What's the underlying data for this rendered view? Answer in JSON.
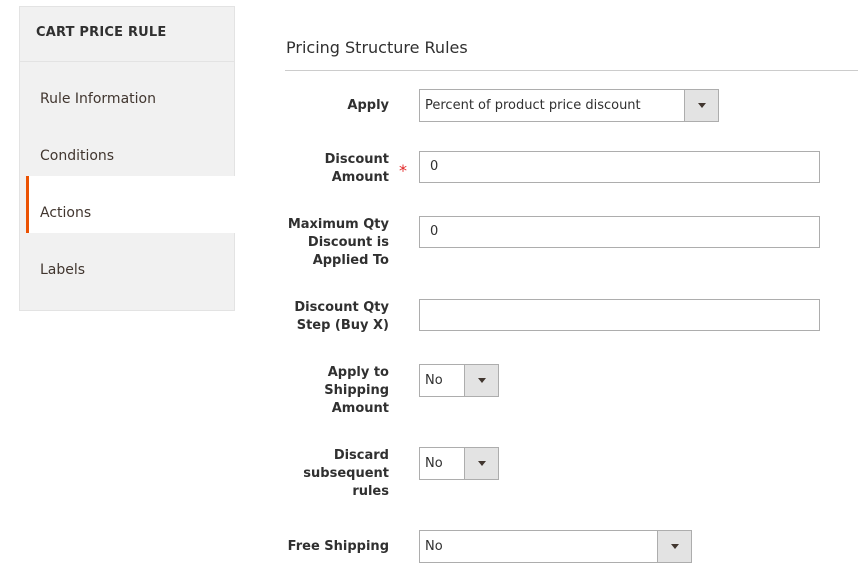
{
  "sidebar": {
    "title": "CART PRICE RULE",
    "items": [
      {
        "label": "Rule Information"
      },
      {
        "label": "Conditions"
      },
      {
        "label": "Actions"
      },
      {
        "label": "Labels"
      }
    ]
  },
  "main": {
    "section_title": "Pricing Structure Rules",
    "fields": {
      "apply": {
        "label": "Apply",
        "value": "Percent of product price discount"
      },
      "discount_amount": {
        "label": "Discount Amount",
        "required_mark": "*",
        "value": "0"
      },
      "max_qty": {
        "label": "Maximum Qty Discount is Applied To",
        "value": "0"
      },
      "discount_step": {
        "label": "Discount Qty Step (Buy X)",
        "value": ""
      },
      "apply_shipping": {
        "label": "Apply to Shipping Amount",
        "value": "No"
      },
      "discard_rules": {
        "label": "Discard subsequent rules",
        "value": "No"
      },
      "free_shipping": {
        "label": "Free Shipping",
        "value": "No"
      }
    }
  },
  "colors": {
    "accent": "#eb5202",
    "required": "#e22626",
    "sidebar_bg": "#f1f1f1"
  }
}
